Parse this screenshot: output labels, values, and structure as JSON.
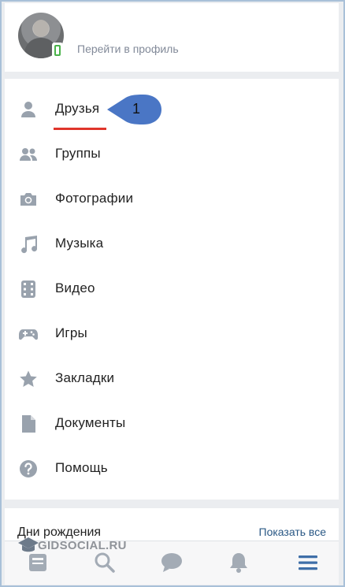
{
  "profile": {
    "link_text": "Перейти в профиль"
  },
  "menu": {
    "items": [
      {
        "label": "Друзья",
        "icon": "person-icon"
      },
      {
        "label": "Группы",
        "icon": "group-icon"
      },
      {
        "label": "Фотографии",
        "icon": "camera-icon"
      },
      {
        "label": "Музыка",
        "icon": "music-note-icon"
      },
      {
        "label": "Видео",
        "icon": "film-icon"
      },
      {
        "label": "Игры",
        "icon": "gamepad-icon"
      },
      {
        "label": "Закладки",
        "icon": "star-icon"
      },
      {
        "label": "Документы",
        "icon": "document-icon"
      },
      {
        "label": "Помощь",
        "icon": "help-icon"
      }
    ]
  },
  "annotation": {
    "callout_number": "1",
    "callout_color": "#4a76c5",
    "underline_color": "#e0352b"
  },
  "birthdays": {
    "title": "Дни рождения",
    "show_all": "Показать все"
  },
  "tabbar": {
    "tabs": [
      "news-icon",
      "search-icon",
      "messages-icon",
      "notifications-icon",
      "menu-icon"
    ]
  },
  "watermark": {
    "text": "GIDSOCIAL.RU"
  },
  "colors": {
    "icon_gray": "#99a2ad",
    "link_gray": "#828a99",
    "accent_blue": "#2a5885",
    "menu_active_blue": "#3f6fa8"
  }
}
